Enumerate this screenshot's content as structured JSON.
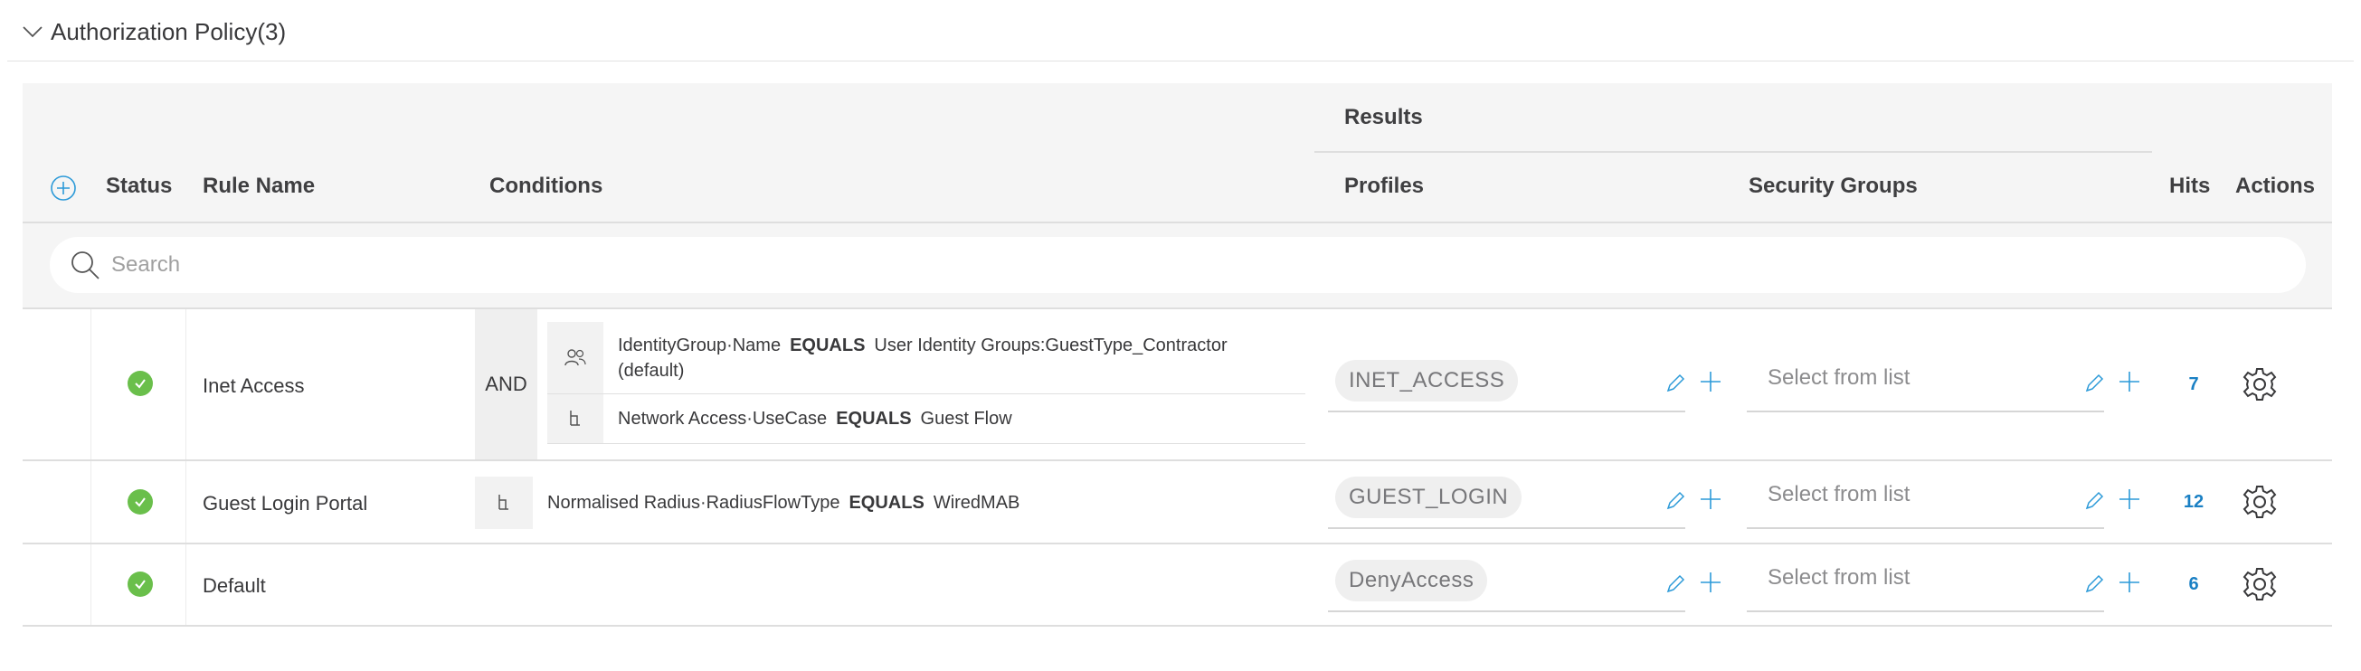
{
  "section": {
    "title": "Authorization Policy(3)"
  },
  "columns": {
    "status": "Status",
    "rule_name": "Rule Name",
    "conditions": "Conditions",
    "results": "Results",
    "profiles": "Profiles",
    "security_groups": "Security Groups",
    "hits": "Hits",
    "actions": "Actions"
  },
  "search": {
    "placeholder": "Search",
    "value": ""
  },
  "status_color": "#6abf4b",
  "accent_color": "#1a80c4",
  "rows": [
    {
      "status": "enabled",
      "rule_name": "Inet Access",
      "operator": "AND",
      "conditions": [
        {
          "icon": "user-group-icon",
          "attribute": "IdentityGroup·Name",
          "operator": "EQUALS",
          "value": "User Identity Groups:GuestType_Contractor",
          "value_line2": "(default)"
        },
        {
          "icon": "network-tree-icon",
          "attribute": "Network Access·UseCase",
          "operator": "EQUALS",
          "value": "Guest Flow"
        }
      ],
      "profile": "INET_ACCESS",
      "security_group_placeholder": "Select from list",
      "hits": "7"
    },
    {
      "status": "enabled",
      "rule_name": "Guest Login Portal",
      "conditions": [
        {
          "icon": "network-tree-icon",
          "attribute": "Normalised Radius·RadiusFlowType",
          "operator": "EQUALS",
          "value": "WiredMAB"
        }
      ],
      "profile": "GUEST_LOGIN",
      "security_group_placeholder": "Select from list",
      "hits": "12"
    },
    {
      "status": "enabled",
      "rule_name": "Default",
      "conditions": [],
      "profile": "DenyAccess",
      "security_group_placeholder": "Select from list",
      "hits": "6"
    }
  ]
}
